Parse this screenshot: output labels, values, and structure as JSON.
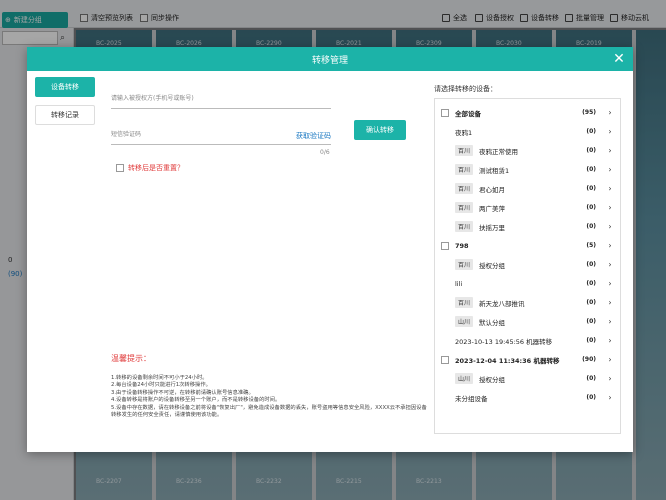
{
  "background": {
    "new_group_btn": "新建分组",
    "check1": "清空预览列表",
    "check2": "同步操作",
    "toolbar": [
      "全选",
      "设备授权",
      "设备转移",
      "批量管理",
      "移动云机"
    ],
    "side_values": [
      "0",
      "(90)"
    ],
    "cell_labels": [
      "BC-2025",
      "BC-2026",
      "BC-2290",
      "BC-2021",
      "BC-2309",
      "BC-2030",
      "BC-2019",
      "BC-2207",
      "BC-2236",
      "BC-2232",
      "BC-2215",
      "BC-2213"
    ]
  },
  "modal": {
    "title": "转移管理",
    "close": "✕",
    "tabs": [
      "设备转移",
      "转移记录"
    ],
    "form": {
      "target_placeholder": "请输入被授权方(手机号或账号)",
      "code_placeholder": "短信验证码",
      "get_code": "获取验证码",
      "counter": "0/6",
      "confirm_btn": "确认转移",
      "reset_option": "转移后是否重置？"
    },
    "tips_title": "温馨提示：",
    "tips": [
      "1.转移的设备剩余时间不可小于24小时。",
      "2.每台设备24小时只能进行1次转移操作。",
      "3.由于设备转移操作不可逆，在转移前请确认账号信息准确。",
      "4.设备转移是将账户的设备转移至另一个账户，而不是转移设备的时间。",
      "5.设备中存在数据，请在转移设备之前将设备\"恢复出厂\"，避免造成设备数据的丢失，账号盗用等信息安全风险，XXXX云不承担因设备转移发生的任何安全责任，请谨慎使用该功能。"
    ],
    "device_list_title": "请选择转移的设备：",
    "device_list": [
      {
        "type": "group",
        "checkbox": true,
        "name": "全部设备",
        "count": "(95)"
      },
      {
        "type": "item",
        "tag": "",
        "name": "夜鸦1",
        "count": "(0)"
      },
      {
        "type": "item",
        "tag": "百川",
        "name": "夜鸦正常使用",
        "count": "(0)"
      },
      {
        "type": "item",
        "tag": "百川",
        "name": "测试租赁1",
        "count": "(0)"
      },
      {
        "type": "item",
        "tag": "百川",
        "name": "君心如月",
        "count": "(0)"
      },
      {
        "type": "item",
        "tag": "百川",
        "name": "两广美萍",
        "count": "(0)"
      },
      {
        "type": "item",
        "tag": "百川",
        "name": "扶摇万里",
        "count": "(0)"
      },
      {
        "type": "group",
        "checkbox": true,
        "name": "798",
        "count": "(5)"
      },
      {
        "type": "item",
        "tag": "百川",
        "name": "授权分组",
        "count": "(0)"
      },
      {
        "type": "item",
        "tag": "",
        "name": "lili",
        "count": "(0)"
      },
      {
        "type": "item",
        "tag": "百川",
        "name": "新天龙八部推讯",
        "count": "(0)"
      },
      {
        "type": "item",
        "tag": "山川",
        "name": "默认分组",
        "count": "(0)"
      },
      {
        "type": "item",
        "tag": "",
        "name": "2023-10-13 19:45:56 机器转移",
        "count": "(0)"
      },
      {
        "type": "group",
        "checkbox": true,
        "name": "2023-12-04 11:34:36 机器转移",
        "count": "(90)"
      },
      {
        "type": "item",
        "tag": "山川",
        "name": "授权分组",
        "count": "(0)"
      },
      {
        "type": "item",
        "tag": "",
        "name": "未分组设备",
        "count": "(0)"
      }
    ]
  }
}
